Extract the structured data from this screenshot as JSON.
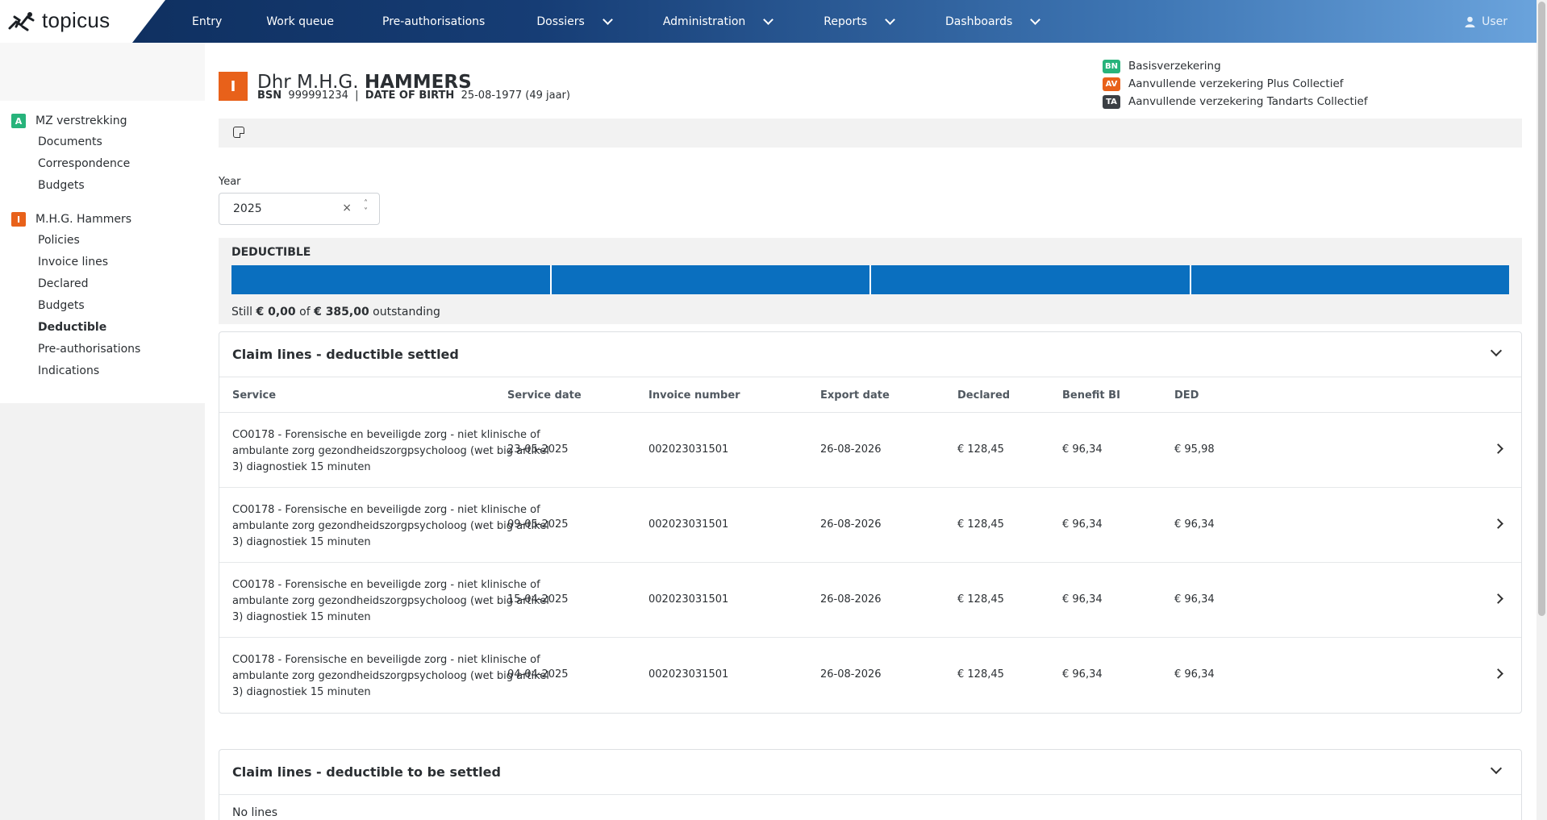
{
  "app": {
    "logo_text": "topicus",
    "user_label": "User"
  },
  "nav": {
    "items": [
      {
        "label": "Entry",
        "dropdown": false
      },
      {
        "label": "Work queue",
        "dropdown": false
      },
      {
        "label": "Pre-authorisations",
        "dropdown": false
      },
      {
        "label": "Dossiers",
        "dropdown": true
      },
      {
        "label": "Administration",
        "dropdown": true
      },
      {
        "label": "Reports",
        "dropdown": true
      },
      {
        "label": "Dashboards",
        "dropdown": true
      }
    ]
  },
  "sidebar": {
    "group_a": {
      "badge": "A",
      "badge_color": "#27b37b",
      "title": "MZ verstrekking",
      "links": [
        "Documents",
        "Correspondence",
        "Budgets"
      ]
    },
    "group_i": {
      "badge": "I",
      "badge_color": "#e8611a",
      "title": "M.H.G. Hammers",
      "links": [
        "Policies",
        "Invoice lines",
        "Declared",
        "Budgets",
        "Deductible",
        "Pre-authorisations",
        "Indications"
      ],
      "active": "Deductible"
    }
  },
  "person": {
    "badge": "I",
    "salutation": "Dhr M.H.G.",
    "surname": "HAMMERS",
    "bsn_label": "BSN",
    "bsn": "999991234",
    "separator": "|",
    "dob_label": "DATE OF BIRTH",
    "dob": "25-08-1977 (49 jaar)"
  },
  "policies": [
    {
      "code": "BN",
      "color": "#27b37b",
      "name": "Basisverzekering"
    },
    {
      "code": "AV",
      "color": "#e8611a",
      "name": "Aanvullende verzekering Plus Collectief"
    },
    {
      "code": "TA",
      "color": "#3b3f44",
      "name": "Aanvullende verzekering Tandarts Collectief"
    }
  ],
  "filter": {
    "year_label": "Year",
    "year_value": "2025",
    "clear_glyph": "×"
  },
  "deductible": {
    "title": "DEDUCTIBLE",
    "status_prefix": "Still",
    "outstanding_amount": "€ 0,00",
    "of_word": "of",
    "total_amount": "€ 385,00",
    "status_suffix": "outstanding",
    "used_fraction": 1.0,
    "bar_color": "#0a6fbf",
    "segments": 4
  },
  "settled": {
    "title": "Claim lines - deductible settled",
    "columns": [
      "Service",
      "Service date",
      "Invoice number",
      "Export date",
      "Declared",
      "Benefit BI",
      "DED"
    ],
    "rows": [
      {
        "service": "CO0178 - Forensische en beveiligde zorg - niet klinische of ambulante zorg gezondheidszorgpsycholoog (wet big artikel 3) diagnostiek 15 minuten",
        "service_date": "23-05-2025",
        "invoice_number": "002023031501",
        "export_date": "26-08-2026",
        "declared": "€ 128,45",
        "benefit": "€ 96,34",
        "ded": "€ 95,98"
      },
      {
        "service": "CO0178 - Forensische en beveiligde zorg - niet klinische of ambulante zorg gezondheidszorgpsycholoog (wet big artikel 3) diagnostiek 15 minuten",
        "service_date": "09-05-2025",
        "invoice_number": "002023031501",
        "export_date": "26-08-2026",
        "declared": "€ 128,45",
        "benefit": "€ 96,34",
        "ded": "€ 96,34"
      },
      {
        "service": "CO0178 - Forensische en beveiligde zorg - niet klinische of ambulante zorg gezondheidszorgpsycholoog (wet big artikel 3) diagnostiek 15 minuten",
        "service_date": "15-04-2025",
        "invoice_number": "002023031501",
        "export_date": "26-08-2026",
        "declared": "€ 128,45",
        "benefit": "€ 96,34",
        "ded": "€ 96,34"
      },
      {
        "service": "CO0178 - Forensische en beveiligde zorg - niet klinische of ambulante zorg gezondheidszorgpsycholoog (wet big artikel 3) diagnostiek 15 minuten",
        "service_date": "04-04-2025",
        "invoice_number": "002023031501",
        "export_date": "26-08-2026",
        "declared": "€ 128,45",
        "benefit": "€ 96,34",
        "ded": "€ 96,34"
      }
    ]
  },
  "to_settle": {
    "title": "Claim lines - deductible to be settled",
    "empty_text": "No lines"
  }
}
